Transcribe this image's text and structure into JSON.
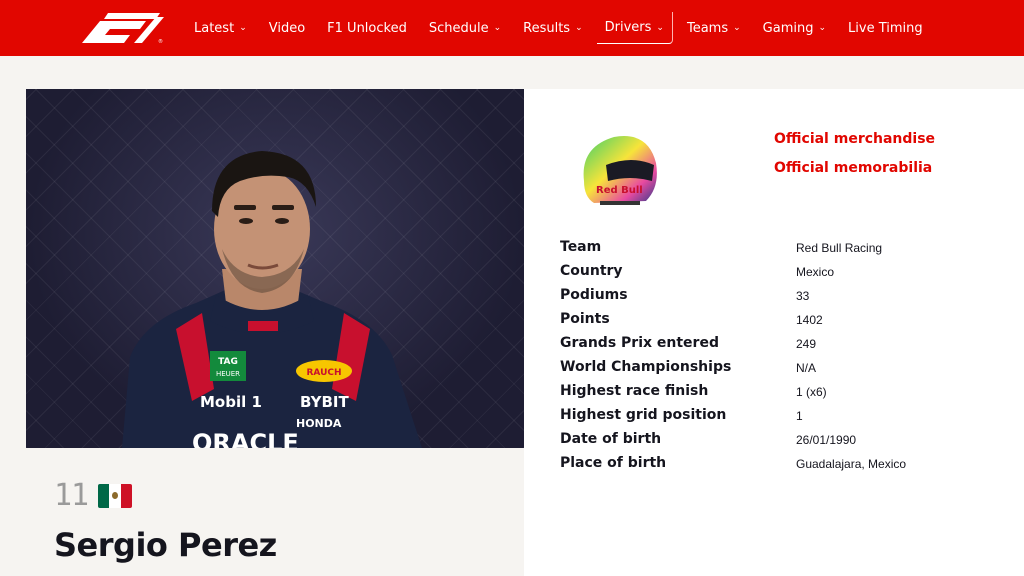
{
  "nav": {
    "items": [
      {
        "label": "Latest",
        "has_dropdown": true
      },
      {
        "label": "Video",
        "has_dropdown": false
      },
      {
        "label": "F1 Unlocked",
        "has_dropdown": false
      },
      {
        "label": "Schedule",
        "has_dropdown": true
      },
      {
        "label": "Results",
        "has_dropdown": true
      },
      {
        "label": "Drivers",
        "has_dropdown": true
      },
      {
        "label": "Teams",
        "has_dropdown": true
      },
      {
        "label": "Gaming",
        "has_dropdown": true
      },
      {
        "label": "Live Timing",
        "has_dropdown": false
      }
    ],
    "active": "Drivers",
    "chevron": "⌄"
  },
  "colors": {
    "brand_red": "#e10600",
    "flag_green": "#006847",
    "flag_white": "#ffffff",
    "flag_red": "#ce1126"
  },
  "driver": {
    "number": "11",
    "name": "Sergio Perez",
    "flag_icon": "mexico-flag-icon"
  },
  "links": {
    "merchandise": "Official merchandise",
    "memorabilia": "Official memorabilia"
  },
  "suit_text": {
    "tag": "TAG\nHEUER",
    "mobil": "Mobil 1",
    "bybit": "BYBIT",
    "honda": "HONDA",
    "oracle": "ORACLE",
    "rauch": "RAUCH"
  },
  "stats": [
    {
      "label": "Team",
      "value": "Red Bull Racing"
    },
    {
      "label": "Country",
      "value": "Mexico"
    },
    {
      "label": "Podiums",
      "value": "33"
    },
    {
      "label": "Points",
      "value": "1402"
    },
    {
      "label": "Grands Prix entered",
      "value": "249"
    },
    {
      "label": "World Championships",
      "value": "N/A"
    },
    {
      "label": "Highest race finish",
      "value": "1 (x6)"
    },
    {
      "label": "Highest grid position",
      "value": "1"
    },
    {
      "label": "Date of birth",
      "value": "26/01/1990"
    },
    {
      "label": "Place of birth",
      "value": "Guadalajara, Mexico"
    }
  ]
}
